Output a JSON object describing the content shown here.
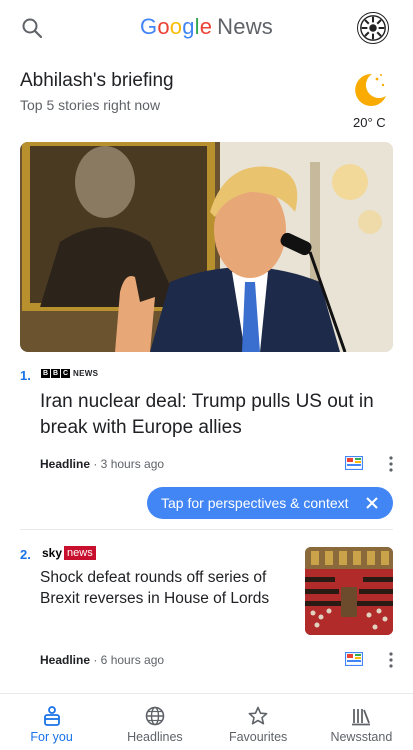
{
  "header": {
    "logo_google": [
      "G",
      "o",
      "o",
      "g",
      "l",
      "e"
    ],
    "logo_news": "News"
  },
  "briefing": {
    "title": "Abhilash's briefing",
    "subtitle": "Top 5 stories right now"
  },
  "weather": {
    "icon": "crescent-moon-icon",
    "temperature": "20° C"
  },
  "stories": [
    {
      "rank": "1.",
      "source_box": [
        "B",
        "B",
        "C"
      ],
      "source_suffix": "NEWS",
      "headline": "Iran nuclear deal: Trump pulls US out in break with Europe allies",
      "label": "Headline",
      "time": " · 3 hours ago"
    },
    {
      "rank": "2.",
      "source_word": "sky",
      "source_badge": "news",
      "headline": "Shock defeat rounds off series of Brexit reverses in House of Lords",
      "label": "Headline",
      "time": " · 6 hours ago"
    }
  ],
  "tooltip": {
    "text": "Tap for perspectives & context"
  },
  "bottom_nav": [
    {
      "label": "For you",
      "icon": "for-you-icon",
      "active": true
    },
    {
      "label": "Headlines",
      "icon": "globe-icon",
      "active": false
    },
    {
      "label": "Favourites",
      "icon": "star-icon",
      "active": false
    },
    {
      "label": "Newsstand",
      "icon": "newsstand-icon",
      "active": false
    }
  ],
  "colors": {
    "accent": "#1a73e8",
    "tooltip_bg": "#4285f4",
    "weather_moon": "#f9ab00",
    "sky_red": "#c8102e"
  }
}
